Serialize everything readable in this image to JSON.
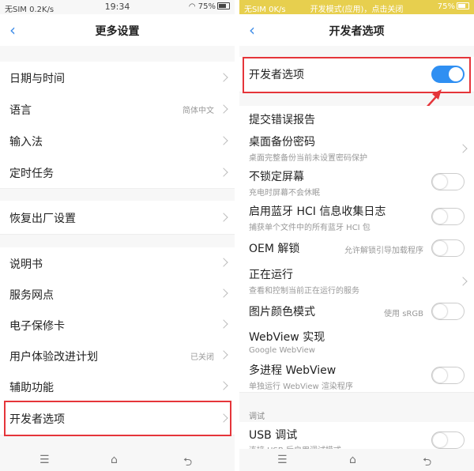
{
  "left": {
    "status": {
      "carrier": "无SIM 0.2K/s",
      "time": "19:34",
      "battery": "75%"
    },
    "nav": {
      "back_icon": "chevron-left-icon",
      "title": "更多设置"
    },
    "groups": [
      [
        {
          "label": "日期与时间",
          "value": ""
        },
        {
          "label": "语言",
          "value": "简体中文"
        },
        {
          "label": "输入法",
          "value": ""
        },
        {
          "label": "定时任务",
          "value": ""
        }
      ],
      [
        {
          "label": "恢复出厂设置",
          "value": ""
        }
      ],
      [
        {
          "label": "说明书",
          "value": ""
        },
        {
          "label": "服务网点",
          "value": ""
        },
        {
          "label": "电子保修卡",
          "value": ""
        },
        {
          "label": "用户体验改进计划",
          "value": "已关闭"
        },
        {
          "label": "辅助功能",
          "value": ""
        },
        {
          "label": "开发者选项",
          "value": ""
        }
      ]
    ]
  },
  "right": {
    "status": {
      "carrier": "无SIM 0K/s",
      "notice": "开发模式(应用)，点击关闭",
      "time": "19:34",
      "battery": "75%"
    },
    "nav": {
      "back_icon": "chevron-left-icon",
      "title": "开发者选项"
    },
    "master": {
      "label": "开发者选项",
      "on": true
    },
    "items": [
      {
        "label": "提交错误报告",
        "sub": "",
        "value": "",
        "control": "none"
      },
      {
        "label": "桌面备份密码",
        "sub": "桌面完整备份当前未设置密码保护",
        "value": "",
        "control": "chevron"
      },
      {
        "label": "不锁定屏幕",
        "sub": "充电时屏幕不会休眠",
        "value": "",
        "control": "toggle",
        "on": false
      },
      {
        "label": "启用蓝牙 HCI 信息收集日志",
        "sub": "捕获单个文件中的所有蓝牙 HCI 包",
        "value": "",
        "control": "toggle",
        "on": false
      },
      {
        "label": "OEM 解锁",
        "sub": "",
        "value": "允许解锁引导加载程序",
        "control": "toggle",
        "on": false
      },
      {
        "label": "正在运行",
        "sub": "查看和控制当前正在运行的服务",
        "value": "",
        "control": "chevron"
      },
      {
        "label": "图片颜色模式",
        "sub": "",
        "value": "使用 sRGB",
        "control": "toggle",
        "on": false
      },
      {
        "label": "WebView 实现",
        "sub": "Google WebView",
        "value": "",
        "control": "none"
      },
      {
        "label": "多进程 WebView",
        "sub": "单独运行 WebView 渲染程序",
        "value": "",
        "control": "toggle",
        "on": false
      }
    ],
    "debug_section": "调试",
    "usb": {
      "label": "USB 调试",
      "sub": "连接 USB 后启用调试模式",
      "on": false
    }
  },
  "bottom_icons": [
    "menu-icon",
    "home-icon",
    "back-icon"
  ],
  "colors": {
    "accent": "#2f8ff2",
    "highlight": "#e5353a",
    "dev_status_bar": "#e7cf4e"
  }
}
